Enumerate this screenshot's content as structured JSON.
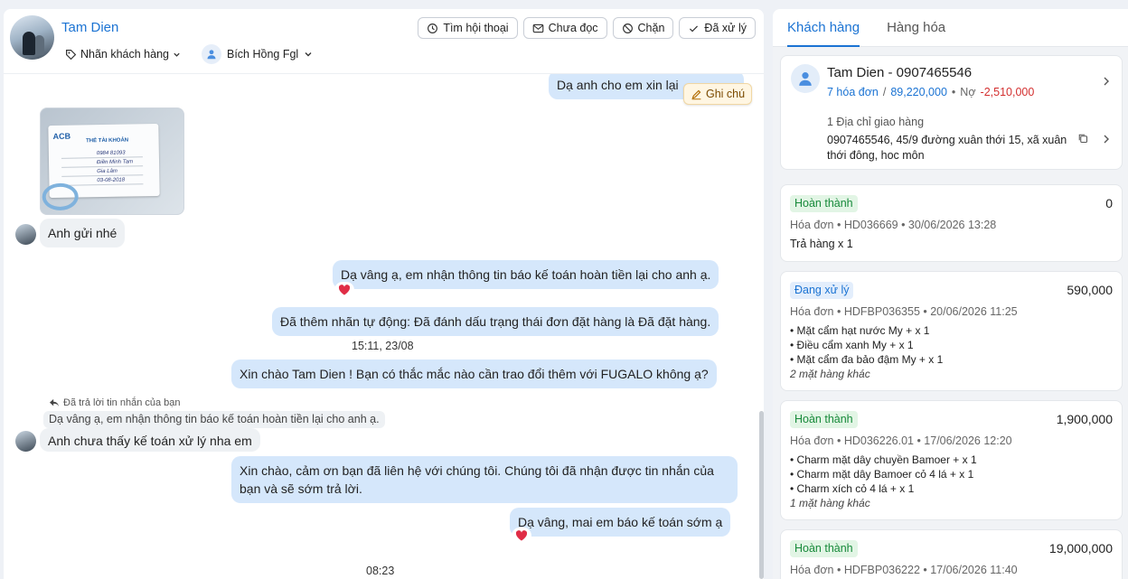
{
  "chat": {
    "contact_name": "Tam Dien",
    "tag_label": "Nhãn khách hàng",
    "assignee": "Bích Hồng Fgl",
    "buttons": {
      "find": "Tìm hội thoại",
      "unread": "Chưa đọc",
      "block": "Chặn",
      "resolved": "Đã xử lý"
    },
    "note_label": "Ghi chú",
    "messages": {
      "m1": "Dạ anh cho em xin lại",
      "card_bank": "ACB",
      "card_title": "THẺ TÀI KHOẢN",
      "card_number": "0984 81093",
      "card_holder": "Điền Minh Tam",
      "card_branch": "Gia Lâm",
      "card_date": "03-08-2018",
      "m2": "Anh gửi nhé",
      "m3": "Dạ vâng ạ, em nhận thông tin báo kế toán hoàn tiền lại cho anh ạ.",
      "m4": "Đã thêm nhãn tự động: Đã đánh dấu trạng thái đơn đặt hàng là Đã đặt hàng.",
      "time1": "15:11, 23/08",
      "m5": "Xin chào Tam Dien ! Bạn có thắc mắc nào cần trao đổi thêm với FUGALO không ạ?",
      "reply_hint": "Đã trả lời tin nhắn của bạn",
      "reply_quote": "Dạ vâng ạ, em nhận thông tin báo kế toán hoàn tiền lại cho anh ạ.",
      "m6": "Anh chưa thấy kế toán xử lý nha em",
      "m7": "Xin chào, cảm ơn bạn đã liên hệ với chúng tôi. Chúng tôi đã nhận được tin nhắn của bạn và sẽ sớm trả lời.",
      "m8": "Dạ vâng, mai em báo kế toán sớm ạ",
      "time2": "08:23"
    }
  },
  "panel": {
    "tabs": [
      "Khách hàng",
      "Hàng hóa"
    ],
    "customer": {
      "name": "Tam Dien - 0907465546",
      "orders": "7 hóa đơn",
      "sep": "/",
      "total": "89,220,000",
      "dot": "•",
      "debt_label": "Nợ",
      "debt": "-2,510,000",
      "address_count": "1 Địa chỉ giao hàng",
      "address": "0907465546, 45/9 đường xuân thới 15, xã xuân thới đông, hoc môn"
    },
    "orders": [
      {
        "status": "Hoàn thành",
        "amount": "0",
        "meta": "Hóa đơn • HD036669 • 30/06/2026 13:28",
        "items": [
          "Trả hàng x 1"
        ],
        "more": ""
      },
      {
        "status": "Đang xử lý",
        "amount": "590,000",
        "meta": "Hóa đơn • HDFBP036355 • 20/06/2026 11:25",
        "items": [
          "• Mặt cẩm hạt nước My + x 1",
          "• Điều cẩm xanh My + x 1",
          "• Mặt cẩm đa bảo đậm My + x 1"
        ],
        "more": "2 mặt hàng khác"
      },
      {
        "status": "Hoàn thành",
        "amount": "1,900,000",
        "meta": "Hóa đơn • HD036226.01 • 17/06/2026 12:20",
        "items": [
          "• Charm mặt dây chuyền Bamoer + x 1",
          "• Charm mặt dây Bamoer cỏ 4 lá + x 1",
          "• Charm xích cỏ 4 lá + x 1"
        ],
        "more": "1 mặt hàng khác"
      },
      {
        "status": "Hoàn thành",
        "amount": "19,000,000",
        "meta": "Hóa đơn • HDFBP036222 • 17/06/2026 11:40",
        "items": [],
        "more": ""
      }
    ]
  },
  "colors": {
    "accent": "#1b73d3",
    "bubble_out": "#d5e7fb",
    "success": "#178a3a",
    "danger": "#d32f2f"
  }
}
